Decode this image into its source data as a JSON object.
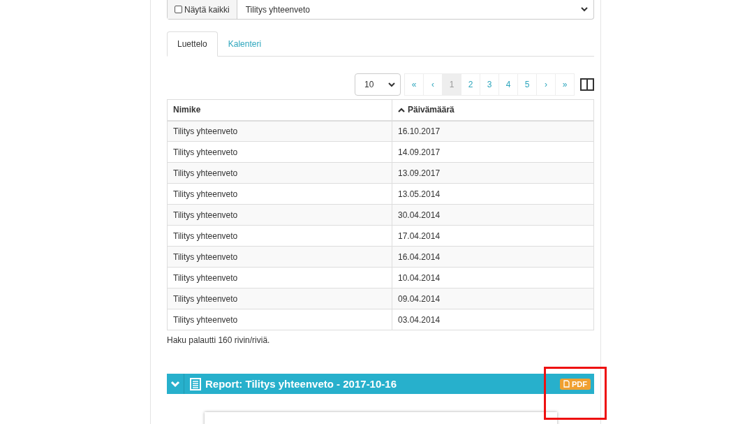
{
  "filter": {
    "show_all": {
      "label": "Näytä kaikki",
      "checked": false
    },
    "report_type": "Tilitys yhteenveto"
  },
  "tabs": [
    {
      "label": "Luettelo",
      "selected": true
    },
    {
      "label": "Kalenteri",
      "selected": false
    }
  ],
  "pagination": {
    "page_size": "10",
    "pages": [
      {
        "label": "«",
        "selected": false
      },
      {
        "label": "‹",
        "selected": false
      },
      {
        "label": "1",
        "selected": true
      },
      {
        "label": "2",
        "selected": false
      },
      {
        "label": "3",
        "selected": false
      },
      {
        "label": "4",
        "selected": false
      },
      {
        "label": "5",
        "selected": false
      },
      {
        "label": "›",
        "selected": false
      },
      {
        "label": "»",
        "selected": false
      }
    ]
  },
  "table": {
    "columns": [
      {
        "label": "Nimike",
        "sorted": false
      },
      {
        "label": "Päivämäärä",
        "sorted": true
      }
    ],
    "rows": [
      [
        "Tilitys yhteenveto",
        "16.10.2017"
      ],
      [
        "Tilitys yhteenveto",
        "14.09.2017"
      ],
      [
        "Tilitys yhteenveto",
        "13.09.2017"
      ],
      [
        "Tilitys yhteenveto",
        "13.05.2014"
      ],
      [
        "Tilitys yhteenveto",
        "30.04.2014"
      ],
      [
        "Tilitys yhteenveto",
        "17.04.2014"
      ],
      [
        "Tilitys yhteenveto",
        "16.04.2014"
      ],
      [
        "Tilitys yhteenveto",
        "10.04.2014"
      ],
      [
        "Tilitys yhteenveto",
        "09.04.2014"
      ],
      [
        "Tilitys yhteenveto",
        "03.04.2014"
      ]
    ]
  },
  "result_count": "Haku palautti 160 rivin/riviä.",
  "report": {
    "title": "Report: Tilitys yhteenveto - 2017-10-16",
    "expanded": true,
    "pdf_button": "PDF"
  }
}
